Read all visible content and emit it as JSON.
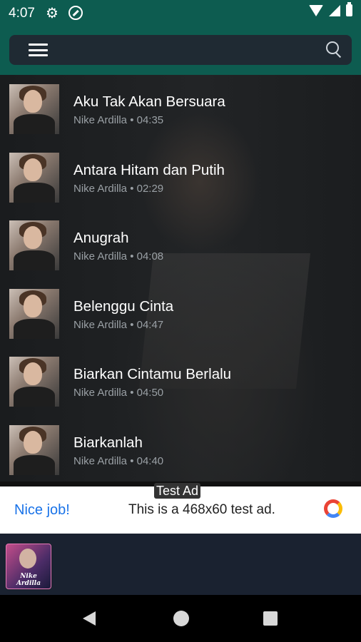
{
  "status_bar": {
    "time": "4:07",
    "icons": [
      "gear-icon",
      "sync-icon",
      "wifi-icon",
      "signal-icon",
      "battery-icon"
    ]
  },
  "header": {
    "background": "#0d5c50",
    "menu_icon": "menu-icon",
    "search_icon": "search-icon"
  },
  "songs": [
    {
      "title": "Aku Tak Akan Bersuara",
      "meta": "Nike Ardilla • 04:35"
    },
    {
      "title": "Antara Hitam dan Putih",
      "meta": "Nike Ardilla • 02:29"
    },
    {
      "title": "Anugrah",
      "meta": "Nike Ardilla • 04:08"
    },
    {
      "title": "Belenggu Cinta",
      "meta": "Nike Ardilla • 04:47"
    },
    {
      "title": "Biarkan Cintamu Berlalu",
      "meta": "Nike Ardilla • 04:50"
    },
    {
      "title": "Biarkanlah",
      "meta": "Nike Ardilla • 04:40"
    }
  ],
  "ad": {
    "label": "Test Ad",
    "cta": "Nice job!",
    "text": "This is a 468x60 test ad."
  },
  "player": {
    "album_text": "Nike Ardilla"
  },
  "nav": {
    "icons": [
      "back-icon",
      "home-icon",
      "recent-apps-icon"
    ]
  }
}
